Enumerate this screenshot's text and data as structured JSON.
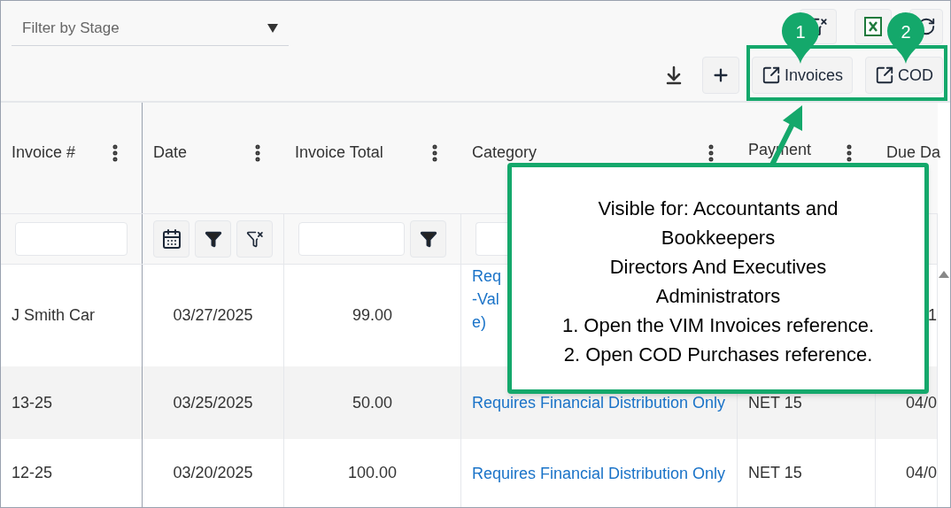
{
  "filter": {
    "placeholder": "Filter by Stage"
  },
  "toolbar": {
    "buttons": [
      {
        "label": "Invoices"
      },
      {
        "label": "COD"
      }
    ]
  },
  "table": {
    "columns": [
      {
        "label": "Invoice #",
        "kind": "text"
      },
      {
        "label": "Date",
        "kind": "date"
      },
      {
        "label": "Invoice Total",
        "kind": "number"
      },
      {
        "label": "Category",
        "kind": "text"
      },
      {
        "label": "Payment",
        "kind": "none"
      },
      {
        "label": "Due Da",
        "kind": "none"
      }
    ],
    "rows": [
      {
        "invoice": "J Smith Car",
        "date": "03/27/2025",
        "total": "99.00",
        "category": "Req\n-Val\ne)",
        "due": "1"
      },
      {
        "invoice": "13-25",
        "date": "03/25/2025",
        "total": "50.00",
        "category": "Requires Financial Distribution Only",
        "payment": "NET 15",
        "due": "04/0"
      },
      {
        "invoice": "12-25",
        "date": "03/20/2025",
        "total": "100.00",
        "category": "Requires Financial Distribution Only",
        "payment": "NET 15",
        "due": "04/0"
      }
    ]
  },
  "callout": {
    "markers": [
      "1",
      "2"
    ],
    "text": "Visible for: Accountants and\nBookkeepers\nDirectors And Executives\nAdministrators\n1. Open the VIM Invoices reference.\n2. Open COD Purchases reference."
  }
}
